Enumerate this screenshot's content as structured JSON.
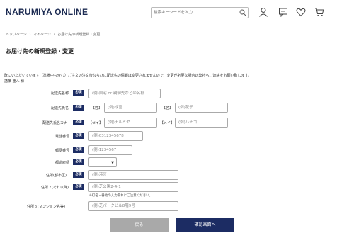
{
  "header": {
    "logo": "NARUMIYA ONLINE",
    "search_placeholder": "検索キーワードを入力",
    "icons": [
      "search-icon",
      "user-icon",
      "message-icon",
      "heart-icon",
      "cart-icon"
    ]
  },
  "breadcrumb": {
    "items": [
      "トップページ",
      "›",
      "マイページ",
      "›",
      "お届け先の新規登録・変更"
    ]
  },
  "page_title": "お届け先の新規登録・変更",
  "notice": "既にいただいています（準備中も含む）ご注文の注文後ならびに配送先の情報は変更されませんので、変更が必要な場合は弊社へご連絡をお願い致します。",
  "customer": "諸橋 重人 様",
  "required_label": "必須",
  "form": {
    "address_name": {
      "label": "配送先名称",
      "placeholder": "(例)自宅 or 親御先などの名称"
    },
    "name": {
      "label": "配送先氏名",
      "sei_label": "【姓】",
      "sei_placeholder": "(例)成宮",
      "mei_label": "【名】",
      "mei_placeholder": "(例)花子"
    },
    "kana": {
      "label": "配送先氏名カナ",
      "sei_label": "【セイ】",
      "sei_placeholder": "(例)ナルミヤ",
      "mei_label": "【メイ】",
      "mei_placeholder": "(例)ハナコ"
    },
    "phone": {
      "label": "電話番号",
      "placeholder": "(例)0312345678"
    },
    "zip": {
      "label": "郵便番号",
      "placeholder": "(例)1234567"
    },
    "prefecture": {
      "label": "都道府県",
      "value": ""
    },
    "city": {
      "label": "住所(都市区)",
      "placeholder": "(例)港区"
    },
    "address2": {
      "label": "住所２(それ以降)",
      "placeholder": "(例)芝公園2-4-1",
      "note": "※町名・番地の入力漏れにご注意ください。"
    },
    "address3": {
      "label": "住所３(マンション名等)",
      "placeholder": "(例)芝パークビル8階9号"
    }
  },
  "buttons": {
    "back": "戻る",
    "confirm": "確認画面へ"
  }
}
